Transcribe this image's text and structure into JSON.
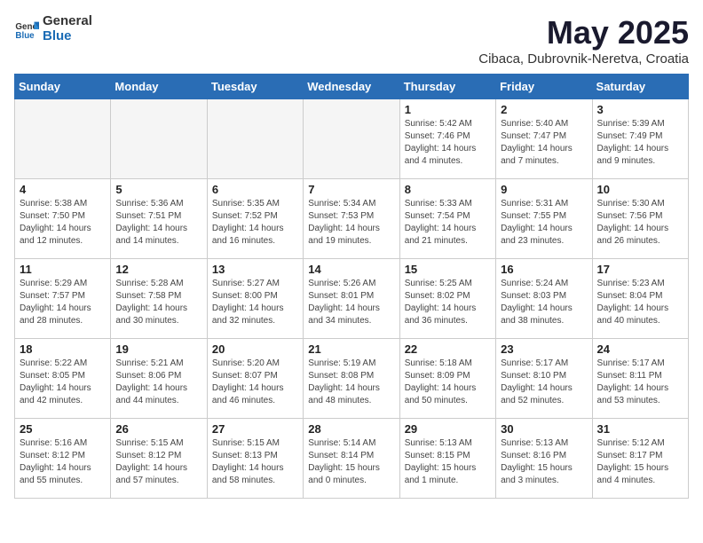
{
  "header": {
    "logo_general": "General",
    "logo_blue": "Blue",
    "month_title": "May 2025",
    "subtitle": "Cibaca, Dubrovnik-Neretva, Croatia"
  },
  "weekdays": [
    "Sunday",
    "Monday",
    "Tuesday",
    "Wednesday",
    "Thursday",
    "Friday",
    "Saturday"
  ],
  "weeks": [
    [
      {
        "day": "",
        "empty": true
      },
      {
        "day": "",
        "empty": true
      },
      {
        "day": "",
        "empty": true
      },
      {
        "day": "",
        "empty": true
      },
      {
        "day": "1",
        "sunrise": "5:42 AM",
        "sunset": "7:46 PM",
        "daylight": "14 hours and 4 minutes."
      },
      {
        "day": "2",
        "sunrise": "5:40 AM",
        "sunset": "7:47 PM",
        "daylight": "14 hours and 7 minutes."
      },
      {
        "day": "3",
        "sunrise": "5:39 AM",
        "sunset": "7:49 PM",
        "daylight": "14 hours and 9 minutes."
      }
    ],
    [
      {
        "day": "4",
        "sunrise": "5:38 AM",
        "sunset": "7:50 PM",
        "daylight": "14 hours and 12 minutes."
      },
      {
        "day": "5",
        "sunrise": "5:36 AM",
        "sunset": "7:51 PM",
        "daylight": "14 hours and 14 minutes."
      },
      {
        "day": "6",
        "sunrise": "5:35 AM",
        "sunset": "7:52 PM",
        "daylight": "14 hours and 16 minutes."
      },
      {
        "day": "7",
        "sunrise": "5:34 AM",
        "sunset": "7:53 PM",
        "daylight": "14 hours and 19 minutes."
      },
      {
        "day": "8",
        "sunrise": "5:33 AM",
        "sunset": "7:54 PM",
        "daylight": "14 hours and 21 minutes."
      },
      {
        "day": "9",
        "sunrise": "5:31 AM",
        "sunset": "7:55 PM",
        "daylight": "14 hours and 23 minutes."
      },
      {
        "day": "10",
        "sunrise": "5:30 AM",
        "sunset": "7:56 PM",
        "daylight": "14 hours and 26 minutes."
      }
    ],
    [
      {
        "day": "11",
        "sunrise": "5:29 AM",
        "sunset": "7:57 PM",
        "daylight": "14 hours and 28 minutes."
      },
      {
        "day": "12",
        "sunrise": "5:28 AM",
        "sunset": "7:58 PM",
        "daylight": "14 hours and 30 minutes."
      },
      {
        "day": "13",
        "sunrise": "5:27 AM",
        "sunset": "8:00 PM",
        "daylight": "14 hours and 32 minutes."
      },
      {
        "day": "14",
        "sunrise": "5:26 AM",
        "sunset": "8:01 PM",
        "daylight": "14 hours and 34 minutes."
      },
      {
        "day": "15",
        "sunrise": "5:25 AM",
        "sunset": "8:02 PM",
        "daylight": "14 hours and 36 minutes."
      },
      {
        "day": "16",
        "sunrise": "5:24 AM",
        "sunset": "8:03 PM",
        "daylight": "14 hours and 38 minutes."
      },
      {
        "day": "17",
        "sunrise": "5:23 AM",
        "sunset": "8:04 PM",
        "daylight": "14 hours and 40 minutes."
      }
    ],
    [
      {
        "day": "18",
        "sunrise": "5:22 AM",
        "sunset": "8:05 PM",
        "daylight": "14 hours and 42 minutes."
      },
      {
        "day": "19",
        "sunrise": "5:21 AM",
        "sunset": "8:06 PM",
        "daylight": "14 hours and 44 minutes."
      },
      {
        "day": "20",
        "sunrise": "5:20 AM",
        "sunset": "8:07 PM",
        "daylight": "14 hours and 46 minutes."
      },
      {
        "day": "21",
        "sunrise": "5:19 AM",
        "sunset": "8:08 PM",
        "daylight": "14 hours and 48 minutes."
      },
      {
        "day": "22",
        "sunrise": "5:18 AM",
        "sunset": "8:09 PM",
        "daylight": "14 hours and 50 minutes."
      },
      {
        "day": "23",
        "sunrise": "5:17 AM",
        "sunset": "8:10 PM",
        "daylight": "14 hours and 52 minutes."
      },
      {
        "day": "24",
        "sunrise": "5:17 AM",
        "sunset": "8:11 PM",
        "daylight": "14 hours and 53 minutes."
      }
    ],
    [
      {
        "day": "25",
        "sunrise": "5:16 AM",
        "sunset": "8:12 PM",
        "daylight": "14 hours and 55 minutes."
      },
      {
        "day": "26",
        "sunrise": "5:15 AM",
        "sunset": "8:12 PM",
        "daylight": "14 hours and 57 minutes."
      },
      {
        "day": "27",
        "sunrise": "5:15 AM",
        "sunset": "8:13 PM",
        "daylight": "14 hours and 58 minutes."
      },
      {
        "day": "28",
        "sunrise": "5:14 AM",
        "sunset": "8:14 PM",
        "daylight": "15 hours and 0 minutes."
      },
      {
        "day": "29",
        "sunrise": "5:13 AM",
        "sunset": "8:15 PM",
        "daylight": "15 hours and 1 minute."
      },
      {
        "day": "30",
        "sunrise": "5:13 AM",
        "sunset": "8:16 PM",
        "daylight": "15 hours and 3 minutes."
      },
      {
        "day": "31",
        "sunrise": "5:12 AM",
        "sunset": "8:17 PM",
        "daylight": "15 hours and 4 minutes."
      }
    ]
  ],
  "labels": {
    "sunrise_prefix": "Sunrise: ",
    "sunset_prefix": "Sunset: ",
    "daylight_prefix": "Daylight: "
  }
}
